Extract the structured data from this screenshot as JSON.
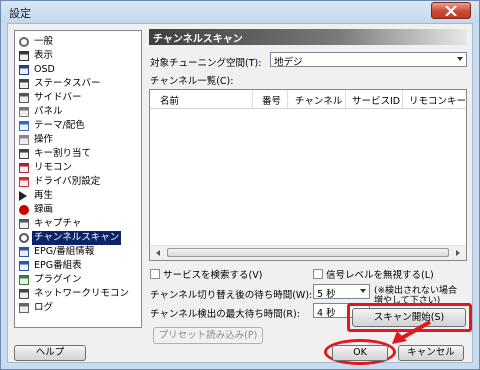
{
  "window": {
    "title": "設定"
  },
  "tree": {
    "items": [
      {
        "label": "一般",
        "icon": "gear-icon"
      },
      {
        "label": "表示",
        "icon": "display-icon"
      },
      {
        "label": "OSD",
        "icon": "osd-icon"
      },
      {
        "label": "ステータスバー",
        "icon": "statusbar-icon"
      },
      {
        "label": "サイドバー",
        "icon": "sidebar-icon"
      },
      {
        "label": "パネル",
        "icon": "panel-icon"
      },
      {
        "label": "テーマ/配色",
        "icon": "theme-icon"
      },
      {
        "label": "操作",
        "icon": "mouse-icon"
      },
      {
        "label": "キー割り当て",
        "icon": "keyboard-icon"
      },
      {
        "label": "リモコン",
        "icon": "remote-icon"
      },
      {
        "label": "ドライバ別設定",
        "icon": "driver-icon"
      },
      {
        "label": "再生",
        "icon": "play-icon"
      },
      {
        "label": "録画",
        "icon": "record-icon"
      },
      {
        "label": "キャプチャ",
        "icon": "camera-icon"
      },
      {
        "label": "チャンネルスキャン",
        "icon": "channel-scan-icon",
        "selected": true
      },
      {
        "label": "EPG/番組情報",
        "icon": "epg-icon"
      },
      {
        "label": "EPG番組表",
        "icon": "program-guide-icon"
      },
      {
        "label": "プラグイン",
        "icon": "plugin-icon"
      },
      {
        "label": "ネットワークリモコン",
        "icon": "network-remote-icon"
      },
      {
        "label": "ログ",
        "icon": "log-icon"
      }
    ]
  },
  "panel": {
    "header": "チャンネルスキャン",
    "tuning_space_label": "対象チューニング空間(T):",
    "tuning_space_value": "地デジ",
    "channel_list_label": "チャンネル一覧(C):",
    "columns": [
      "名前",
      "番号",
      "チャンネル",
      "サービスID",
      "リモコンキー"
    ],
    "check_search_service": "サービスを検索する(V)",
    "check_ignore_signal": "信号レベルを無視する(L)",
    "wait_after_switch_label": "チャンネル切り替え後の待ち時間(W):",
    "wait_after_switch_value": "5 秒",
    "max_wait_label": "チャンネル検出の最大待ち時間(R):",
    "max_wait_value": "4 秒",
    "note": "(※検出されない場合\n増やして下さい)",
    "preset_button": "プリセット読み込み(P)",
    "scan_button": "スキャン開始(S)"
  },
  "footer": {
    "help_button": "ヘルプ",
    "ok_button": "OK",
    "cancel_button": "キャンセル"
  },
  "colors": {
    "highlight": "#e0191f",
    "selection": "#0a246a"
  }
}
